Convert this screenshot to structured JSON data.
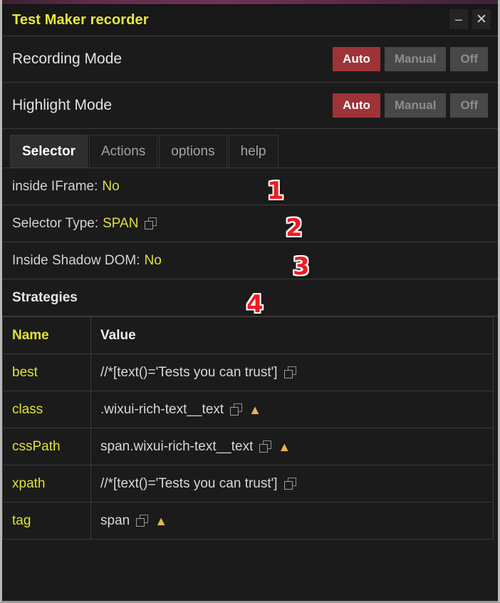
{
  "window": {
    "title": "Test Maker recorder",
    "minimize_label": "–",
    "close_label": "✕"
  },
  "modes": [
    {
      "label": "Recording Mode",
      "options": [
        "Auto",
        "Manual",
        "Off"
      ],
      "selected": "Auto"
    },
    {
      "label": "Highlight Mode",
      "options": [
        "Auto",
        "Manual",
        "Off"
      ],
      "selected": "Auto"
    }
  ],
  "tabs": [
    {
      "label": "Selector",
      "active": true
    },
    {
      "label": "Actions",
      "active": false
    },
    {
      "label": "options",
      "active": false
    },
    {
      "label": "help",
      "active": false
    }
  ],
  "info": [
    {
      "label": "inside IFrame:",
      "value": "No",
      "copy": false
    },
    {
      "label": "Selector Type:",
      "value": "SPAN",
      "copy": true
    },
    {
      "label": "Inside Shadow DOM:",
      "value": "No",
      "copy": false
    }
  ],
  "strategies": {
    "section_title": "Strategies",
    "columns": [
      "Name",
      "Value"
    ],
    "rows": [
      {
        "name": "best",
        "value": "//*[text()='Tests you can trust']",
        "copy": true,
        "warn": false
      },
      {
        "name": "class",
        "value": ".wixui-rich-text__text",
        "copy": true,
        "warn": true
      },
      {
        "name": "cssPath",
        "value": "span.wixui-rich-text__text",
        "copy": true,
        "warn": true
      },
      {
        "name": "xpath",
        "value": "//*[text()='Tests you can trust']",
        "copy": true,
        "warn": false
      },
      {
        "name": "tag",
        "value": "span",
        "copy": true,
        "warn": true
      }
    ]
  },
  "annotations": [
    {
      "number": "1"
    },
    {
      "number": "2"
    },
    {
      "number": "3"
    },
    {
      "number": "4"
    }
  ],
  "colors": {
    "title": "#e8e83a",
    "accent_yellow": "#e0e03a",
    "active_red": "#9e3338",
    "warning": "#e6b553",
    "annotation_red": "#ee1c21",
    "panel_bg": "#1b1b1b",
    "border": "#3a3a3a"
  }
}
